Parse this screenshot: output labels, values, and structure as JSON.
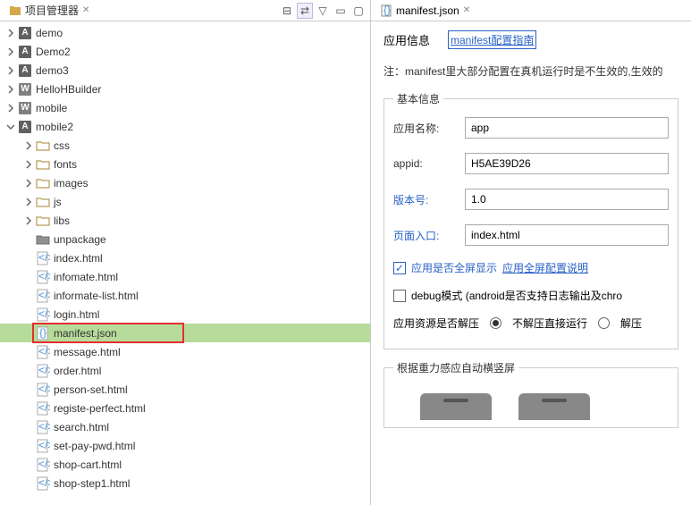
{
  "leftPanel": {
    "title": "项目管理器",
    "tree": [
      {
        "level": 0,
        "expand": "chevron-right",
        "icon": "a",
        "label": "demo"
      },
      {
        "level": 0,
        "expand": "chevron-right",
        "icon": "a",
        "label": "Demo2"
      },
      {
        "level": 0,
        "expand": "chevron-right",
        "icon": "a",
        "label": "demo3"
      },
      {
        "level": 0,
        "expand": "chevron-right",
        "icon": "w",
        "label": "HelloHBuilder"
      },
      {
        "level": 0,
        "expand": "chevron-right",
        "icon": "w",
        "label": "mobile"
      },
      {
        "level": 0,
        "expand": "chevron-down",
        "icon": "a",
        "label": "mobile2"
      },
      {
        "level": 1,
        "expand": "chevron-right",
        "icon": "folder",
        "label": "css"
      },
      {
        "level": 1,
        "expand": "chevron-right",
        "icon": "folder",
        "label": "fonts"
      },
      {
        "level": 1,
        "expand": "chevron-right",
        "icon": "folder",
        "label": "images"
      },
      {
        "level": 1,
        "expand": "chevron-right",
        "icon": "folder",
        "label": "js"
      },
      {
        "level": 1,
        "expand": "chevron-right",
        "icon": "folder",
        "label": "libs"
      },
      {
        "level": 1,
        "expand": "none",
        "icon": "folder-dark",
        "label": "unpackage"
      },
      {
        "level": 1,
        "expand": "none",
        "icon": "html",
        "label": "index.html"
      },
      {
        "level": 1,
        "expand": "none",
        "icon": "html",
        "label": "infomate.html"
      },
      {
        "level": 1,
        "expand": "none",
        "icon": "html",
        "label": "informate-list.html"
      },
      {
        "level": 1,
        "expand": "none",
        "icon": "html",
        "label": "login.html"
      },
      {
        "level": 1,
        "expand": "none",
        "icon": "json",
        "label": "manifest.json",
        "selected": true,
        "highlighted": true
      },
      {
        "level": 1,
        "expand": "none",
        "icon": "html",
        "label": "message.html"
      },
      {
        "level": 1,
        "expand": "none",
        "icon": "html",
        "label": "order.html"
      },
      {
        "level": 1,
        "expand": "none",
        "icon": "html",
        "label": "person-set.html"
      },
      {
        "level": 1,
        "expand": "none",
        "icon": "html",
        "label": "registe-perfect.html"
      },
      {
        "level": 1,
        "expand": "none",
        "icon": "html",
        "label": "search.html"
      },
      {
        "level": 1,
        "expand": "none",
        "icon": "html",
        "label": "set-pay-pwd.html"
      },
      {
        "level": 1,
        "expand": "none",
        "icon": "html",
        "label": "shop-cart.html"
      },
      {
        "level": 1,
        "expand": "none",
        "icon": "html",
        "label": "shop-step1.html"
      }
    ]
  },
  "editor": {
    "tabTitle": "manifest.json",
    "appInfoLabel": "应用信息",
    "manifestGuideLink": "manifest配置指南",
    "noteText": "注：manifest里大部分配置在真机运行时是不生效的,生效的",
    "basicInfoLegend": "基本信息",
    "fields": {
      "appName": {
        "label": "应用名称:",
        "value": "app"
      },
      "appid": {
        "label": "appid:",
        "value": "H5AE39D26"
      },
      "version": {
        "label": "版本号:",
        "value": "1.0"
      },
      "entry": {
        "label": "页面入口:",
        "value": "index.html"
      }
    },
    "fullscreenCheck": "应用是否全屏显示",
    "fullscreenConfigLink": "应用全屏配置说明",
    "debugCheck": "debug模式 (android是否支持日志输出及chro",
    "resourceLabel": "应用资源是否解压",
    "radioOption1": "不解压直接运行",
    "radioOption2": "解压",
    "orientationLegend": "根据重力感应自动横竖屏"
  }
}
